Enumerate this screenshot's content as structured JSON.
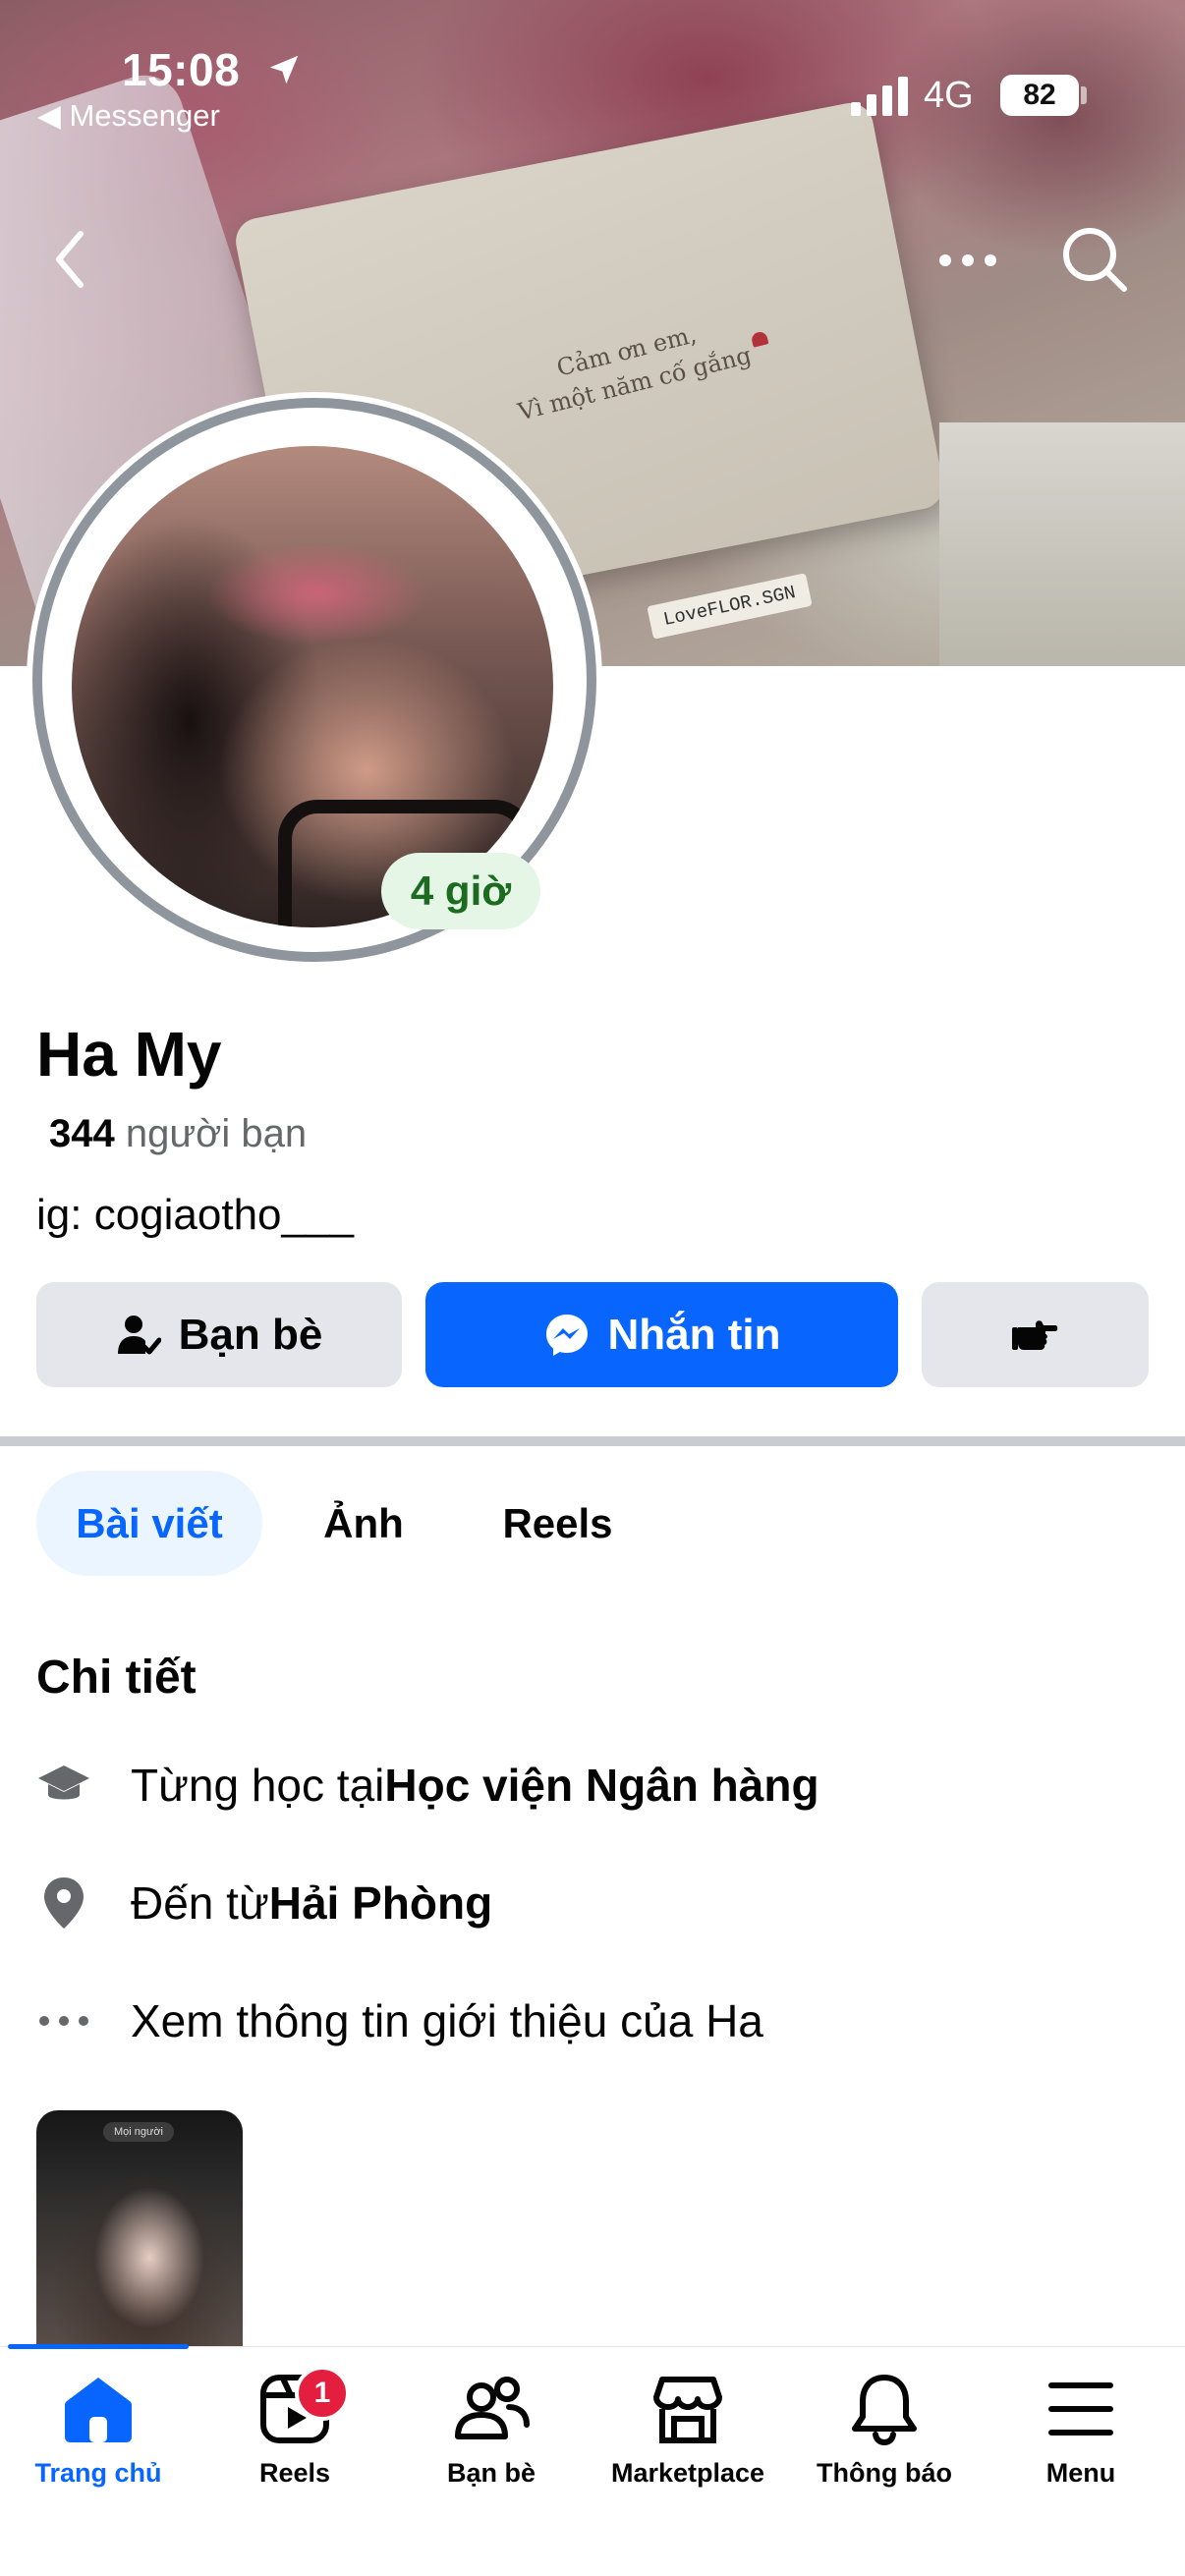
{
  "status_bar": {
    "time": "15:08",
    "back_app": "◀ Messenger",
    "network": "4G",
    "battery": "82"
  },
  "cover": {
    "card_text_line1": "Cảm ơn em,",
    "card_text_line2": "Vì một năm cố gắng",
    "brand_tag": "LoveFLOR.SGN"
  },
  "profile": {
    "story_age": "4 giờ",
    "name": "Ha My",
    "friend_count": "344",
    "friend_label": " người bạn",
    "bio": "ig: cogiaotho___"
  },
  "actions": {
    "friends_label": "Bạn bè",
    "message_label": "Nhắn tin"
  },
  "tabs": [
    {
      "label": "Bài viết",
      "active": true
    },
    {
      "label": "Ảnh",
      "active": false
    },
    {
      "label": "Reels",
      "active": false
    }
  ],
  "details": {
    "title": "Chi tiết",
    "school_prefix": "Từng học tại ",
    "school_name": "Học viện Ngân hàng",
    "home_prefix": "Đến từ ",
    "home_name": "Hải Phòng",
    "about_link": "Xem thông tin giới thiệu của Ha"
  },
  "thumbnail": {
    "pill_text": "Mọi người"
  },
  "bottom_nav": {
    "items": [
      {
        "label": "Trang chủ",
        "icon": "home-icon",
        "active": true
      },
      {
        "label": "Reels",
        "icon": "reels-icon",
        "badge": "1"
      },
      {
        "label": "Bạn bè",
        "icon": "friends-icon"
      },
      {
        "label": "Marketplace",
        "icon": "marketplace-icon"
      },
      {
        "label": "Thông báo",
        "icon": "bell-icon"
      },
      {
        "label": "Menu",
        "icon": "menu-icon"
      }
    ]
  },
  "colors": {
    "accent": "#0866ff",
    "badge": "#e41e3f",
    "story_pill_bg": "#e6f6e6",
    "story_pill_text": "#1d6b21"
  }
}
